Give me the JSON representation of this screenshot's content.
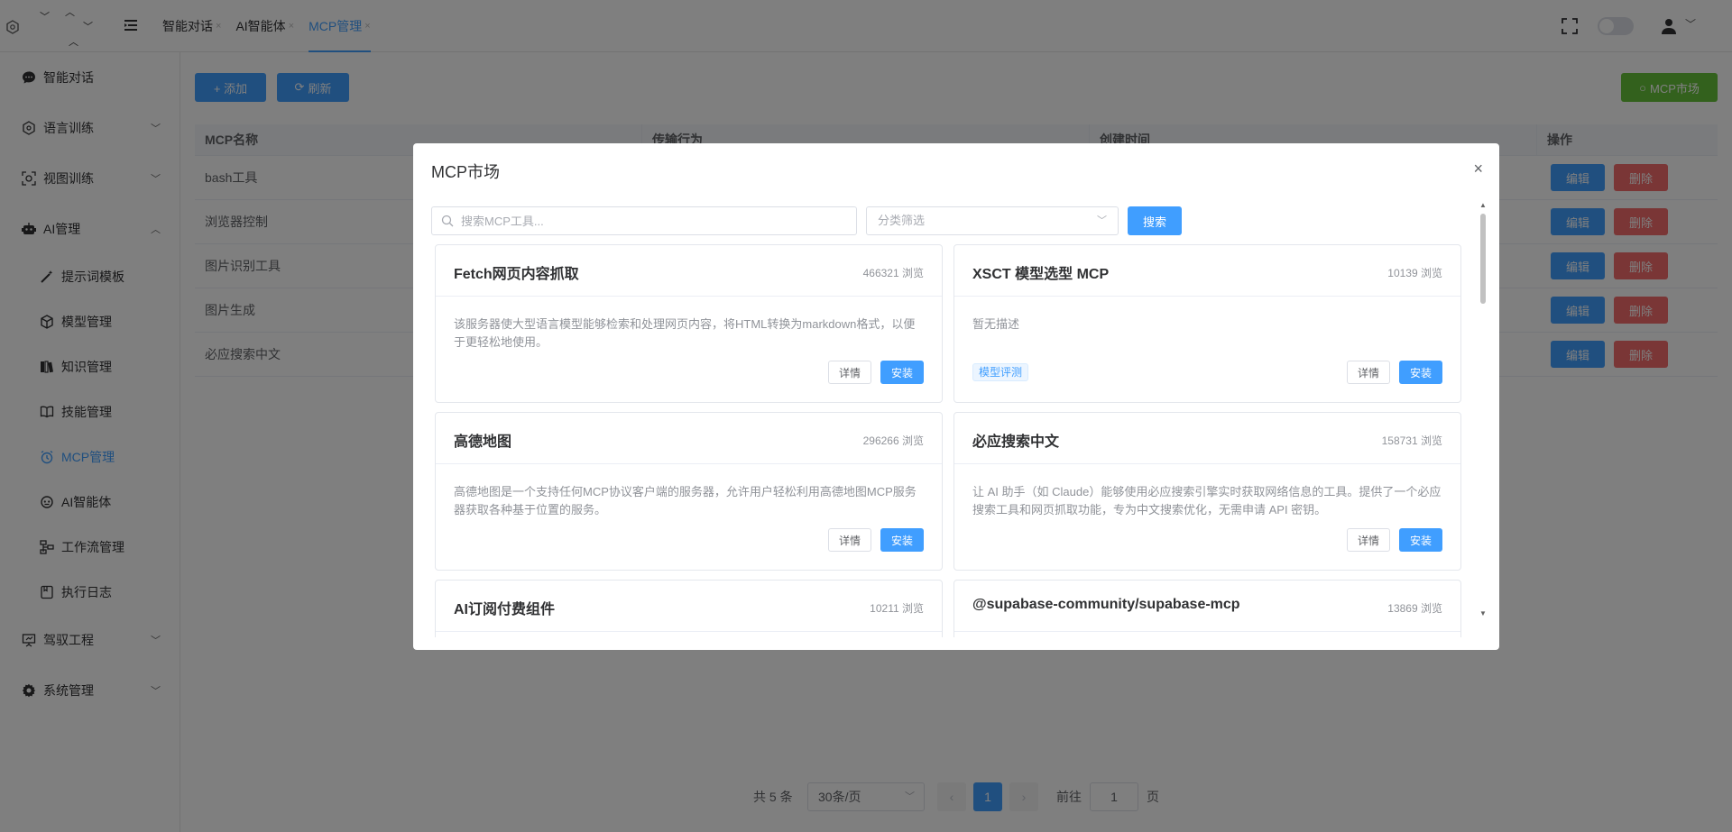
{
  "header": {
    "tabs": [
      {
        "label": "智能对话",
        "close": "×"
      },
      {
        "label": "AI智能体",
        "close": "×"
      },
      {
        "label": "MCP管理",
        "close": "×"
      }
    ]
  },
  "sidebar": {
    "items": [
      {
        "label": "智能对话",
        "icon": "chat-icon"
      },
      {
        "label": "语言训练",
        "icon": "language-train-icon",
        "arrow": "﹀"
      },
      {
        "label": "视图训练",
        "icon": "view-train-icon",
        "arrow": "﹀"
      },
      {
        "label": "AI管理",
        "icon": "robot-icon",
        "arrow": "︿"
      },
      {
        "label": "提示词模板",
        "icon": "magic-wand-icon"
      },
      {
        "label": "模型管理",
        "icon": "cube-icon"
      },
      {
        "label": "知识管理",
        "icon": "books-icon"
      },
      {
        "label": "技能管理",
        "icon": "book-open-icon"
      },
      {
        "label": "MCP管理",
        "icon": "mcp-icon"
      },
      {
        "label": "AI智能体",
        "icon": "agent-icon"
      },
      {
        "label": "工作流管理",
        "icon": "workflow-icon"
      },
      {
        "label": "执行日志",
        "icon": "log-icon"
      },
      {
        "label": "驾驭工程",
        "icon": "presentation-icon",
        "arrow": "﹀"
      },
      {
        "label": "系统管理",
        "icon": "gear-icon",
        "arrow": "﹀"
      }
    ]
  },
  "toolbar": {
    "add_label": "+ 添加",
    "refresh_label": "刷新",
    "market_label": "MCP市场"
  },
  "table": {
    "columns": [
      "MCP名称",
      "传输行为",
      "创建时间",
      "操作"
    ],
    "rows": [
      {
        "name": "bash工具"
      },
      {
        "name": "浏览器控制"
      },
      {
        "name": "图片识别工具"
      },
      {
        "name": "图片生成"
      },
      {
        "name": "必应搜索中文"
      }
    ],
    "edit_label": "编辑",
    "delete_label": "删除"
  },
  "pagination": {
    "total": "共 5 条",
    "page_size": "30条/页",
    "prev": "‹",
    "current": "1",
    "next": "›",
    "goto_label": "前往",
    "goto_value": "1",
    "page_suffix": "页"
  },
  "modal": {
    "title": "MCP市场",
    "close": "×",
    "search_placeholder": "搜索MCP工具...",
    "category_placeholder": "分类筛选",
    "search_button": "搜索",
    "detail_label": "详情",
    "install_label": "安装",
    "cards": [
      {
        "name": "Fetch网页内容抓取",
        "views": "466321 浏览",
        "desc": "该服务器使大型语言模型能够检索和处理网页内容，将HTML转换为markdown格式，以便于更轻松地使用。",
        "tag": ""
      },
      {
        "name": "XSCT 模型选型 MCP",
        "views": "10139 浏览",
        "desc": "暂无描述",
        "tag": "模型评测"
      },
      {
        "name": "高德地图",
        "views": "296266 浏览",
        "desc": "高德地图是一个支持任何MCP协议客户端的服务器，允许用户轻松利用高德地图MCP服务器获取各种基于位置的服务。",
        "tag": ""
      },
      {
        "name": "必应搜索中文",
        "views": "158731 浏览",
        "desc": "让 AI 助手（如 Claude）能够使用必应搜索引擎实时获取网络信息的工具。提供了一个必应搜索工具和网页抓取功能，专为中文搜索优化，无需申请 API 密钥。",
        "tag": ""
      },
      {
        "name": "AI订阅付费组件",
        "views": "10211 浏览",
        "desc": "",
        "tag": ""
      },
      {
        "name": "@supabase-community/supabase-mcp",
        "views": "13869 浏览",
        "desc": "",
        "tag": ""
      }
    ]
  },
  "colors": {
    "primary": "#409eff",
    "success": "#67c23a",
    "danger": "#f56c6c"
  }
}
